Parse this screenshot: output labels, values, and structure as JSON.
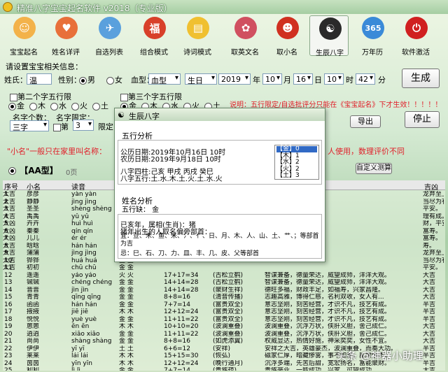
{
  "window": {
    "title": "精准八字宝宝起名软件 v2018（专业版）"
  },
  "toolbar": [
    {
      "label": "宝宝起名",
      "color": "#f3b24a",
      "glyph": "☺"
    },
    {
      "label": "姓名详评",
      "color": "#e8703a",
      "glyph": "♥"
    },
    {
      "label": "自选列表",
      "color": "#5aa0dd",
      "glyph": "✈"
    },
    {
      "label": "组合模式",
      "color": "#d8402a",
      "glyph": "福"
    },
    {
      "label": "诗词模式",
      "color": "#f0c030",
      "glyph": "▤"
    },
    {
      "label": "取英文名",
      "color": "#d05060",
      "glyph": "✿"
    },
    {
      "label": "取小名",
      "color": "#d03020",
      "glyph": "☻"
    },
    {
      "label": "生辰八字",
      "color": "#2a2a2a",
      "glyph": "☯"
    },
    {
      "label": "万年历",
      "color": "#3a8ad8",
      "glyph": "365"
    },
    {
      "label": "软件激活",
      "color": "#d02020",
      "glyph": "⏻"
    }
  ],
  "form": {
    "section_label": "请设置宝宝相关信息：",
    "surname_label": "姓氏：",
    "surname_value": "温",
    "gender_label": "性别：",
    "male_label": "男",
    "female_label": "女",
    "blood_label": "血型：",
    "blood_value": "血型",
    "birthday_value": "生日",
    "year_value": "2019",
    "year_label": "年",
    "month_value": "10",
    "month_label": "月",
    "day_value": "16",
    "day_label": "日",
    "hour_value": "10",
    "hour_label": "时",
    "minute_value": "42",
    "minute_label": "分",
    "generate_label": "生成",
    "char2_label": "第二个字五行限",
    "char3_label": "第三个字五行限",
    "elements": [
      "金",
      "木",
      "水",
      "火",
      "土"
    ],
    "name_count_label": "名字个数：",
    "name_count_value": "三字",
    "char_position_label": "名字限定：",
    "char_pos_prefix": "第",
    "char_pos_value": "3",
    "char_pos_suffix": "限定",
    "note": "说明：五行限定/自选批评分只能在《宝宝起名》下才生效！！！！！",
    "export_label": "导出",
    "stop_label": "停止"
  },
  "banner": {
    "left": "\"小名\"一般只在家里叫名称：",
    "right": "人使用，数理评价不同"
  },
  "type_label": "【AA型】",
  "type_count": "0页",
  "custom_button": "自定义测算",
  "table": {
    "headers": [
      "序号",
      "小名",
      "读音",
      "",
      "",
      "",
      "",
      "",
      "吉凶"
    ],
    "rows": [
      [
        "1",
        "彦彦",
        "yàn yàn",
        "火 火",
        "",
        "",
        "",
        "龙弃至上。",
        "大吉"
      ],
      [
        "2",
        "静静",
        "jìng jìng",
        "金 金",
        "",
        "",
        "",
        "当尽为有成。",
        "大吉"
      ],
      [
        "3",
        "圣圣",
        "shèng shèng",
        "金 金",
        "",
        "",
        "",
        "平安。",
        "大吉"
      ],
      [
        "4",
        "禹禹",
        "yǔ yǔ",
        "土 土",
        "",
        "",
        "",
        "理有成。",
        "大吉"
      ],
      [
        "5",
        "卉卉",
        "huì huì",
        "水 水",
        "",
        "",
        "",
        "财，平安。",
        "大凶"
      ],
      [
        "6",
        "秦秦",
        "qín qín",
        "金 金",
        "",
        "",
        "",
        "富寿。",
        "大凶"
      ],
      [
        "7",
        "儿儿",
        "ér ér",
        "金 金",
        "",
        "",
        "",
        "富寿。",
        "大凶"
      ],
      [
        "8",
        "晗晗",
        "hán hán",
        "火 火",
        "",
        "",
        "",
        "寿。",
        "大吉"
      ],
      [
        "9",
        "蒲蒲",
        "jìng jìng",
        "金 金",
        "",
        "",
        "",
        "龙弃至上。",
        "大吉"
      ],
      [
        "10",
        "铧铧",
        "huá huá",
        "金 金",
        "",
        "",
        "",
        "当尽为有成。",
        "大吉"
      ],
      [
        "11",
        "初初",
        "chū chū",
        "金 金",
        "",
        "",
        "",
        "平安。",
        "大吉"
      ],
      [
        "12",
        "遥遥",
        "yáo yáo",
        "火 火",
        "17+17=34",
        "(古松立鹤)",
        "智谋兼备，德量荣达，威望成师，洋洋大观。",
        "大吉"
      ],
      [
        "13",
        "铖铖",
        "chéng chéng",
        "金 金",
        "14+14=28",
        "(古松立鹤)",
        "智谋兼备，德量荣达，威望成师，洋洋大观。",
        "大吉"
      ],
      [
        "14",
        "晋晋",
        "jìn jìn",
        "金 金",
        "14+14=28",
        "(聚财生祥)",
        "德旺多福，财政丰足，如福寿，兴家昌隆。",
        "大吉"
      ],
      [
        "15",
        "青青",
        "qīng qīng",
        "金 金",
        "8+8=16",
        "(清音传播)",
        "志趣高雅，博得仁慈，名利双收，女人有...",
        "大吉"
      ],
      [
        "16",
        "函函",
        "hán hán",
        "金 金",
        "7+7=14",
        "(富贵双全)",
        "意志坚刚，刻苦经营，才识不凡，技艺有成。",
        "半吉"
      ],
      [
        "17",
        "掖掖",
        "jiē jiē",
        "木 木",
        "12+12=24",
        "(富贵双全)",
        "意志坚刚，刻苦经营，才识不凡，技艺有成。",
        "半吉"
      ],
      [
        "18",
        "悦悦",
        "yuè yuè",
        "金 金",
        "11+11=22",
        "(富贵双全)",
        "意志坚刚，刻苦经营，才识不凡，技艺有成。",
        "半吉"
      ],
      [
        "19",
        "蒽蒽",
        "ēn ēn",
        "木 木",
        "10+10=20",
        "(波澜重叠)",
        "波澜重叠，沉浮万状，侠肝义胆，舍己成仁。",
        "大吉"
      ],
      [
        "20",
        "逍逍",
        "xiāo xiāo",
        "金 金",
        "11+11=22",
        "(波澜重叠)",
        "波澜重叠，沉浮万状，侠肝义胆，舍己成仁。",
        "大吉"
      ],
      [
        "21",
        "尚尚",
        "shàng shàng",
        "金 金",
        "8+8=16",
        "(如虎添翼)",
        "权威显达，热情好施，神采奕奕，女性不宜。",
        "大吉"
      ],
      [
        "22",
        "伊伊",
        "yī yī",
        "土 土",
        "6+6=12",
        "(安祥)",
        "安祥之大吉，英雄豪杰，波澜重叠，而奏大功。",
        "半吉"
      ],
      [
        "23",
        "莱莱",
        "lái lái",
        "木 木",
        "15+15=30",
        "(恢弘)",
        "磁家仁厚，暗藏惨雾，事不如意，乱世怪杰。",
        "半吉"
      ],
      [
        "24",
        "茵茵",
        "yīn yīn",
        "木 木",
        "12+12=24",
        "(晚行通月)",
        "沉浮多端，先苦后甜，宽宏扬名，富能聚财。",
        "半吉"
      ],
      [
        "25",
        "利利",
        "lì lì",
        "金 金",
        "7+7=14",
        "(贵族蕴)",
        "贵族毫业，一能成功，兴家，可望成功。",
        "大吉"
      ],
      [
        "26",
        "铖铖",
        "chéng chéng",
        "金 金",
        "14+14=28",
        "(古松立鹤)",
        "智谋兼备，德量荣达，威望成师，洋洋大观。",
        "大吉"
      ],
      [
        "27",
        "璇璇",
        "xuán xuán",
        "火 火",
        "15+15=30",
        "(古松立鹤)",
        "智谋兼备，德量荣达，威望成师，洋洋大观。",
        "大吉"
      ]
    ]
  },
  "popup": {
    "title": "生辰八字",
    "wuxing_title": "五行分析",
    "solar_line": "公历日期:2019年10月16日 10时",
    "lunar_line": "农历日期:2019年9月18日 10时",
    "bazi_line": "八字四柱:己亥  甲戌  丙戌  癸巳",
    "wuxing_line": "八字五行:土.水.木.土.火.土.水.火",
    "counts": [
      "【金】0",
      "【木】1",
      "【水】2",
      "【火】2",
      "【土】3"
    ],
    "name_title": "姓名分析",
    "lack_line": "五行缺：  金",
    "zodiac_line": "已亥年，属相(生肖)：猪",
    "radical_intro": "猪年出生的人取名偏旁部首：",
    "radical_line": "宜：豆、禾、鱼、米、氵、亻、日、月、木、人、山、土、艹、；等部首为吉",
    "avoid_line": "忌：巳、石、刀、力、皿、丰、几、皮、父等部首"
  },
  "watermark": "头条 @神器小助理"
}
